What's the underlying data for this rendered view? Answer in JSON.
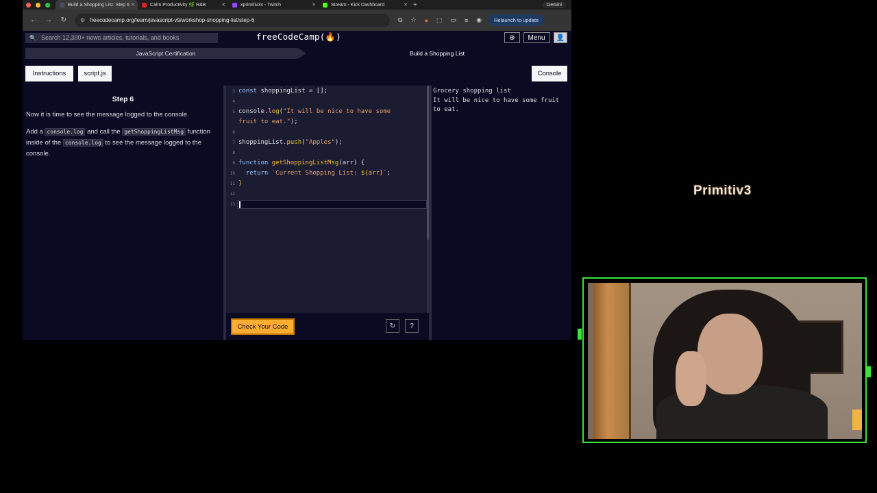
{
  "browser": {
    "tabs": [
      {
        "label": "Build a Shopping List: Step 6",
        "fav": "#4c4c62",
        "active": true
      },
      {
        "label": "Calm Productivity 🌿 R&B",
        "fav": "#e02020",
        "active": false
      },
      {
        "label": "xprimitiv3x - Twitch",
        "fav": "#9146ff",
        "active": false
      },
      {
        "label": "Stream - Kick Dashboard",
        "fav": "#53fc18",
        "active": false
      }
    ],
    "new_tab": "+",
    "gemini": "Gemini",
    "url": "freecodecamp.org/learn/javascript-v9/workshop-shopping-list/step-6",
    "relaunch": "Relaunch to update"
  },
  "fcc": {
    "search_placeholder": "Search 12,300+ news articles, tutorials, and books",
    "logo": "freeCodeCamp(🔥)",
    "menu_label": "Menu",
    "breadcrumb": [
      "JavaScript Certification",
      "Build a Shopping List"
    ],
    "tools": {
      "instructions": "Instructions",
      "file": "script.js",
      "console": "Console"
    },
    "step_title": "Step 6",
    "paragraph1": "Now it is time to see the message logged to the console.",
    "p2_part1": "Add a",
    "p2_code1": "console.log",
    "p2_part2": "and call the",
    "p2_code2": "getShoppingListMsg",
    "p2_part3": "function inside of the",
    "p2_code3": "console.log",
    "p2_part4": "to see the message logged to the console.",
    "check_button": "Check Your Code",
    "console_lines": [
      "Grocery shopping list",
      "It will be nice to have some fruit",
      "to eat."
    ]
  },
  "editor": {
    "lines": [
      {
        "n": "3",
        "segs": [
          [
            "kw",
            "const "
          ],
          [
            "",
            "shoppingList = [];"
          ]
        ]
      },
      {
        "n": "4",
        "segs": []
      },
      {
        "n": "5",
        "segs": [
          [
            "",
            "console."
          ],
          [
            "fn",
            "log"
          ],
          [
            "",
            "("
          ],
          [
            "st",
            "\"It will be nice to have some"
          ]
        ]
      },
      {
        "n": "",
        "segs": [
          [
            "st",
            "fruit to eat.\""
          ],
          [
            "",
            ");"
          ]
        ]
      },
      {
        "n": "6",
        "segs": []
      },
      {
        "n": "7",
        "segs": [
          [
            "",
            "shoppingList."
          ],
          [
            "fn",
            "push"
          ],
          [
            "",
            "("
          ],
          [
            "st",
            "\"Apples\""
          ],
          [
            "",
            ");"
          ]
        ]
      },
      {
        "n": "8",
        "segs": []
      },
      {
        "n": "9",
        "segs": [
          [
            "kw",
            "function "
          ],
          [
            "fn",
            "getShoppingListMsg"
          ],
          [
            "",
            "(arr) {"
          ]
        ]
      },
      {
        "n": "10",
        "segs": [
          [
            "kw",
            "  return "
          ],
          [
            "st",
            "`Current Shopping List: "
          ],
          [
            "fn",
            "${arr}"
          ],
          [
            "st",
            "`"
          ],
          [
            "",
            ";"
          ]
        ]
      },
      {
        "n": "11",
        "segs": [
          [
            "fn",
            "}"
          ]
        ]
      },
      {
        "n": "12",
        "segs": []
      },
      {
        "n": "13",
        "segs": []
      }
    ]
  },
  "stream": {
    "channel_name": "Primitiv3"
  }
}
